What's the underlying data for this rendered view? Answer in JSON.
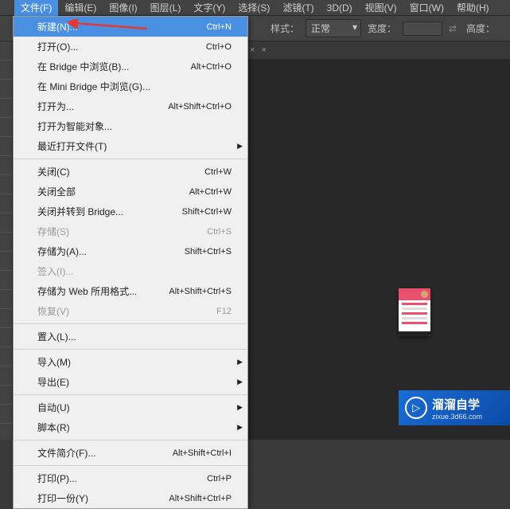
{
  "menubar": {
    "items": [
      {
        "label": "文件(F)"
      },
      {
        "label": "编辑(E)"
      },
      {
        "label": "图像(I)"
      },
      {
        "label": "图层(L)"
      },
      {
        "label": "文字(Y)"
      },
      {
        "label": "选择(S)"
      },
      {
        "label": "滤镜(T)"
      },
      {
        "label": "3D(D)"
      },
      {
        "label": "视图(V)"
      },
      {
        "label": "窗口(W)"
      },
      {
        "label": "帮助(H)"
      }
    ]
  },
  "toolbar": {
    "style_label": "样式：",
    "style_value": "正常",
    "width_label": "宽度：",
    "height_label": "高度："
  },
  "tab": {
    "close": "×"
  },
  "file_menu": {
    "items": [
      {
        "label": "新建(N)...",
        "shortcut": "Ctrl+N",
        "hl": true
      },
      {
        "label": "打开(O)...",
        "shortcut": "Ctrl+O"
      },
      {
        "label": "在 Bridge 中浏览(B)...",
        "shortcut": "Alt+Ctrl+O"
      },
      {
        "label": "在 Mini Bridge 中浏览(G)..."
      },
      {
        "label": "打开为...",
        "shortcut": "Alt+Shift+Ctrl+O"
      },
      {
        "label": "打开为智能对象..."
      },
      {
        "label": "最近打开文件(T)",
        "sub": true
      },
      {
        "sep": true
      },
      {
        "label": "关闭(C)",
        "shortcut": "Ctrl+W"
      },
      {
        "label": "关闭全部",
        "shortcut": "Alt+Ctrl+W"
      },
      {
        "label": "关闭并转到 Bridge...",
        "shortcut": "Shift+Ctrl+W"
      },
      {
        "label": "存储(S)",
        "shortcut": "Ctrl+S",
        "disabled": true
      },
      {
        "label": "存储为(A)...",
        "shortcut": "Shift+Ctrl+S"
      },
      {
        "label": "签入(I)...",
        "disabled": true
      },
      {
        "label": "存储为 Web 所用格式...",
        "shortcut": "Alt+Shift+Ctrl+S"
      },
      {
        "label": "恢复(V)",
        "shortcut": "F12",
        "disabled": true
      },
      {
        "sep": true
      },
      {
        "label": "置入(L)..."
      },
      {
        "sep": true
      },
      {
        "label": "导入(M)",
        "sub": true
      },
      {
        "label": "导出(E)",
        "sub": true
      },
      {
        "sep": true
      },
      {
        "label": "自动(U)",
        "sub": true
      },
      {
        "label": "脚本(R)",
        "sub": true
      },
      {
        "sep": true
      },
      {
        "label": "文件简介(F)...",
        "shortcut": "Alt+Shift+Ctrl+I"
      },
      {
        "sep": true
      },
      {
        "label": "打印(P)...",
        "shortcut": "Ctrl+P"
      },
      {
        "label": "打印一份(Y)",
        "shortcut": "Alt+Shift+Ctrl+P"
      }
    ]
  },
  "watermark": {
    "title": "溜溜自学",
    "url": "zixue.3d66.com",
    "play": "▷"
  }
}
